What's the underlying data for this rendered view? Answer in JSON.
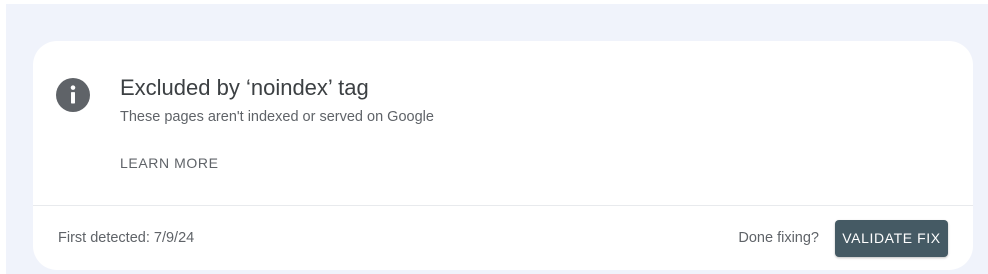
{
  "issue": {
    "icon": "info-icon",
    "title": "Excluded by ‘noindex’ tag",
    "description": "These pages aren't indexed or served on Google",
    "learn_more_label": "LEARN MORE"
  },
  "footer": {
    "first_detected": "First detected: 7/9/24",
    "done_fixing_prompt": "Done fixing?",
    "validate_label": "VALIDATE FIX"
  },
  "colors": {
    "page_background": "#f0f3fb",
    "card_background": "#ffffff",
    "icon_fill": "#5f6368",
    "button_background": "#455a64",
    "button_text": "#ffffff"
  }
}
